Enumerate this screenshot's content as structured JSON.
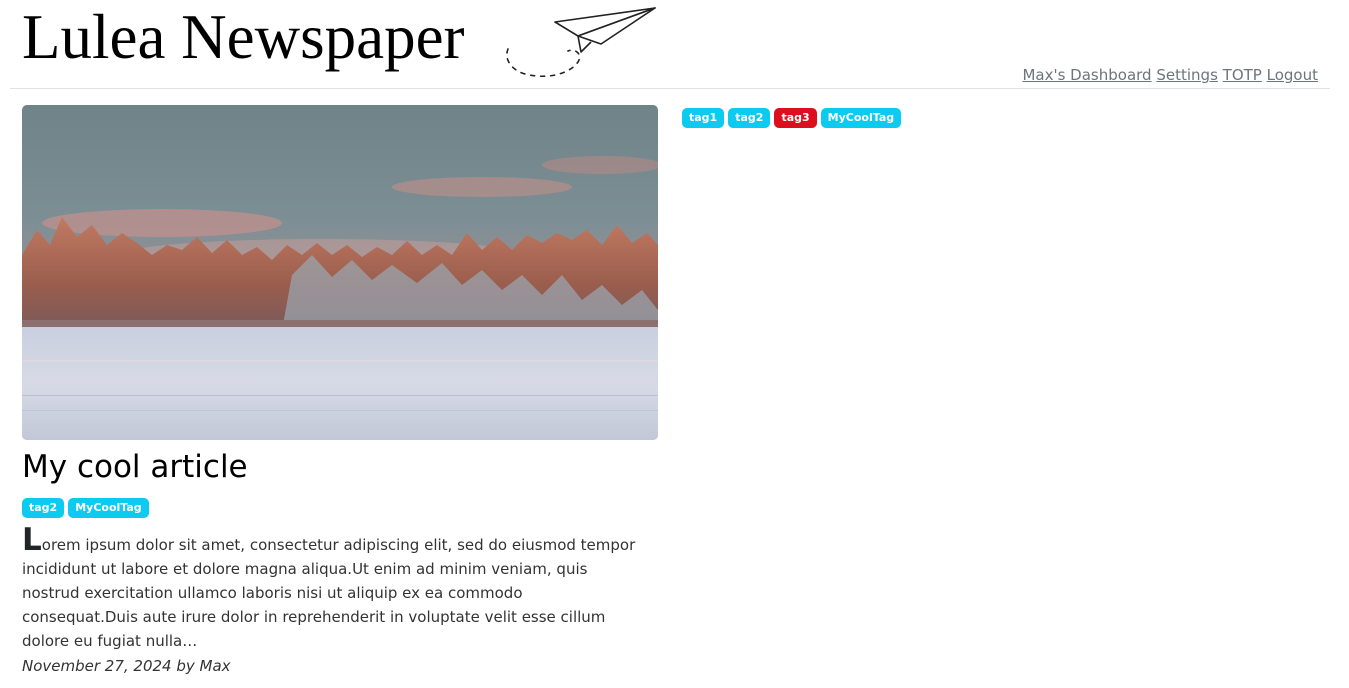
{
  "header": {
    "site_title": "Lulea Newspaper",
    "logo_icon": "paper-plane-icon"
  },
  "nav": {
    "dashboard": "Max's Dashboard",
    "settings": "Settings",
    "totp": "TOTP",
    "logout": "Logout"
  },
  "tag_cloud": [
    {
      "label": "tag1",
      "color": "#0dcaf0"
    },
    {
      "label": "tag2",
      "color": "#0dcaf0"
    },
    {
      "label": "tag3",
      "color": "#dc0f1e"
    },
    {
      "label": "MyCoolTag",
      "color": "#0dcaf0"
    }
  ],
  "article": {
    "title": "My cool article",
    "tags": [
      {
        "label": "tag2",
        "color": "#0dcaf0"
      },
      {
        "label": "MyCoolTag",
        "color": "#0dcaf0"
      }
    ],
    "dropcap": "L",
    "excerpt": "orem ipsum dolor sit amet, consectetur adipiscing elit, sed do eiusmod tempor incididunt ut labore et dolore magna aliqua.Ut enim ad minim veniam, quis nostrud exercitation ullamco laboris nisi ut aliquip ex ea commodo consequat.Duis aute irure dolor in reprehenderit in voluptate velit esse cillum dolore eu fugiat nulla…",
    "byline": "November 27, 2024 by Max"
  },
  "colors": {
    "info_badge": "#0dcaf0",
    "danger_badge": "#dc0f1e",
    "nav_link": "#6c757d"
  }
}
